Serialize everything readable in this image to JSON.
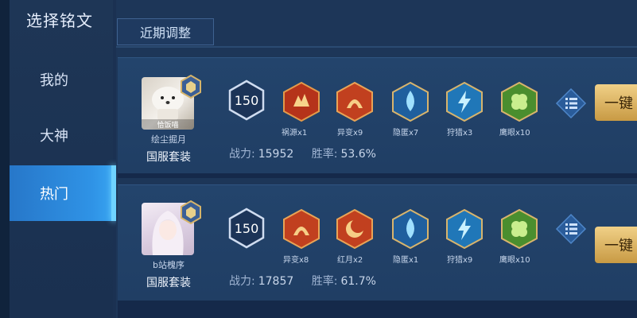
{
  "sidebar": {
    "title": "选择铭文",
    "items": [
      {
        "label": "我的",
        "active": false
      },
      {
        "label": "大神",
        "active": false
      },
      {
        "label": "热门",
        "active": true
      }
    ]
  },
  "tabs": {
    "recent": "近期调整"
  },
  "cards": [
    {
      "avatar_caption": "恰饭喵",
      "player": "绘尘掘月",
      "set": "国服套装",
      "level": "150",
      "runes": [
        {
          "label": "祸源x1",
          "icon": "rune-red-flame-icon",
          "color": "#c9401d"
        },
        {
          "label": "异变x9",
          "icon": "rune-red-arch-icon",
          "color": "#c9401d"
        },
        {
          "label": "隐匿x7",
          "icon": "rune-blue-drop-icon",
          "color": "#2a8fd6"
        },
        {
          "label": "狩猎x3",
          "icon": "rune-blue-lightning-icon",
          "color": "#2a8fd6"
        },
        {
          "label": "鹰眼x10",
          "icon": "rune-green-clover-icon",
          "color": "#5aa53a"
        }
      ],
      "power_label": "战力:",
      "power": "15952",
      "winrate_label": "胜率:",
      "winrate": "53.6%",
      "button": "一键"
    },
    {
      "avatar_caption": "",
      "player": "b站槐序",
      "set": "国服套装",
      "level": "150",
      "runes": [
        {
          "label": "异变x8",
          "icon": "rune-red-arch-icon",
          "color": "#c9401d"
        },
        {
          "label": "红月x2",
          "icon": "rune-red-moon-icon",
          "color": "#c9401d"
        },
        {
          "label": "隐匿x1",
          "icon": "rune-blue-drop-icon",
          "color": "#2a8fd6"
        },
        {
          "label": "狩猎x9",
          "icon": "rune-blue-lightning-icon",
          "color": "#2a8fd6"
        },
        {
          "label": "鹰眼x10",
          "icon": "rune-green-clover-icon",
          "color": "#5aa53a"
        }
      ],
      "power_label": "战力:",
      "power": "17857",
      "winrate_label": "胜率:",
      "winrate": "61.7%",
      "button": "一键"
    }
  ]
}
